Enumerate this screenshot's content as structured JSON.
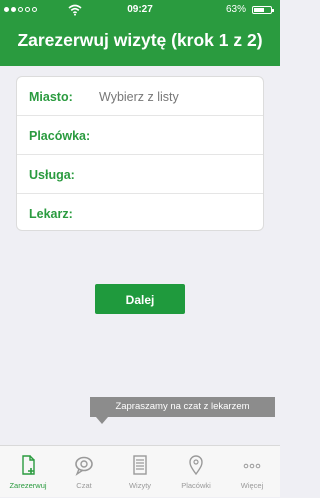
{
  "status_bar": {
    "carrier": "",
    "time": "09:27",
    "battery": "63%",
    "battery_level": 0.63
  },
  "header": {
    "title": "Zarezerwuj wizytę (krok 1 z 2)"
  },
  "form": {
    "rows": [
      {
        "label": "Miasto:",
        "value": "Wybierz z listy"
      },
      {
        "label": "Placówka:",
        "value": ""
      },
      {
        "label": "Usługa:",
        "value": ""
      },
      {
        "label": "Lekarz:",
        "value": ""
      }
    ]
  },
  "actions": {
    "next_label": "Dalej"
  },
  "chat_tooltip": {
    "text": "Zapraszamy na czat z lekarzem"
  },
  "tabbar": {
    "items": [
      {
        "label": "Zarezerwuj",
        "icon": "book-appointment-icon",
        "active": true
      },
      {
        "label": "Czat",
        "icon": "chat-icon",
        "active": false
      },
      {
        "label": "Wizyty",
        "icon": "visits-list-icon",
        "active": false
      },
      {
        "label": "Placówki",
        "icon": "location-pin-icon",
        "active": false
      },
      {
        "label": "Więcej",
        "icon": "more-icon",
        "active": false
      }
    ]
  },
  "colors": {
    "brand_green": "#2a9b3f",
    "tooltip_gray": "#8c8c8c",
    "inactive_tab": "#9a9a9a"
  }
}
